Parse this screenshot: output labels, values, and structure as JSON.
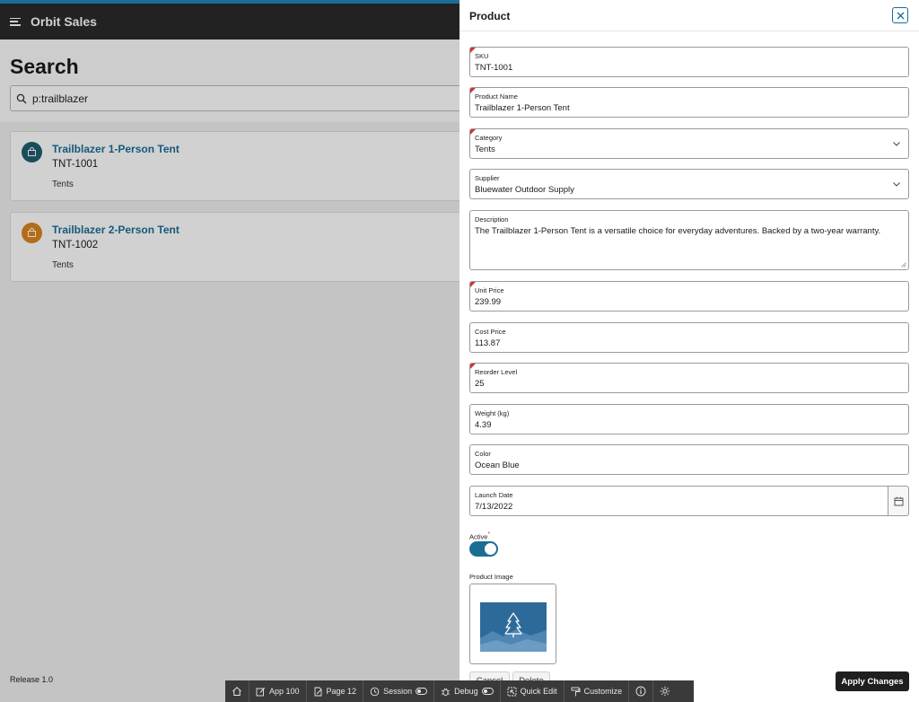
{
  "app": {
    "title": "Orbit Sales"
  },
  "page": {
    "title": "Search"
  },
  "search": {
    "value": "p:trailblazer"
  },
  "results": [
    {
      "title": "Trailblazer 1-Person Tent",
      "sku": "TNT-1001",
      "category": "Tents",
      "badge_color": "#1f5e6e"
    },
    {
      "title": "Trailblazer 2-Person Tent",
      "sku": "TNT-1002",
      "category": "Tents",
      "badge_color": "#d9861f"
    }
  ],
  "footer": {
    "release": "Release 1.0"
  },
  "drawer": {
    "title": "Product",
    "fields": {
      "sku": {
        "label": "SKU",
        "value": "TNT-1001"
      },
      "product_name": {
        "label": "Product Name",
        "value": "Trailblazer 1-Person Tent"
      },
      "category": {
        "label": "Category",
        "value": "Tents"
      },
      "supplier": {
        "label": "Supplier",
        "value": "Bluewater Outdoor Supply"
      },
      "description": {
        "label": "Description",
        "value": "The Trailblazer 1-Person Tent is a versatile choice for everyday adventures. Backed by a two-year warranty."
      },
      "unit_price": {
        "label": "Unit Price",
        "value": "239.99"
      },
      "cost_price": {
        "label": "Cost Price",
        "value": "113.87"
      },
      "reorder_level": {
        "label": "Reorder Level",
        "value": "25"
      },
      "weight": {
        "label": "Weight (kg)",
        "value": "4.39"
      },
      "color": {
        "label": "Color",
        "value": "Ocean Blue"
      },
      "launch_date": {
        "label": "Launch Date",
        "value": "7/13/2022"
      }
    },
    "active": {
      "label": "Active",
      "required_mark": "*",
      "value": true
    },
    "product_image": {
      "label": "Product Image"
    },
    "buttons": {
      "cancel": "Cancel",
      "delete": "Delete",
      "apply": "Apply Changes"
    }
  },
  "devbar": {
    "app": "App 100",
    "page": "Page 12",
    "session": "Session",
    "debug": "Debug",
    "quick_edit": "Quick Edit",
    "customize": "Customize"
  },
  "colors": {
    "accent": "#1a6e96",
    "header": "#2a2a2a",
    "required": "#cc3333"
  }
}
